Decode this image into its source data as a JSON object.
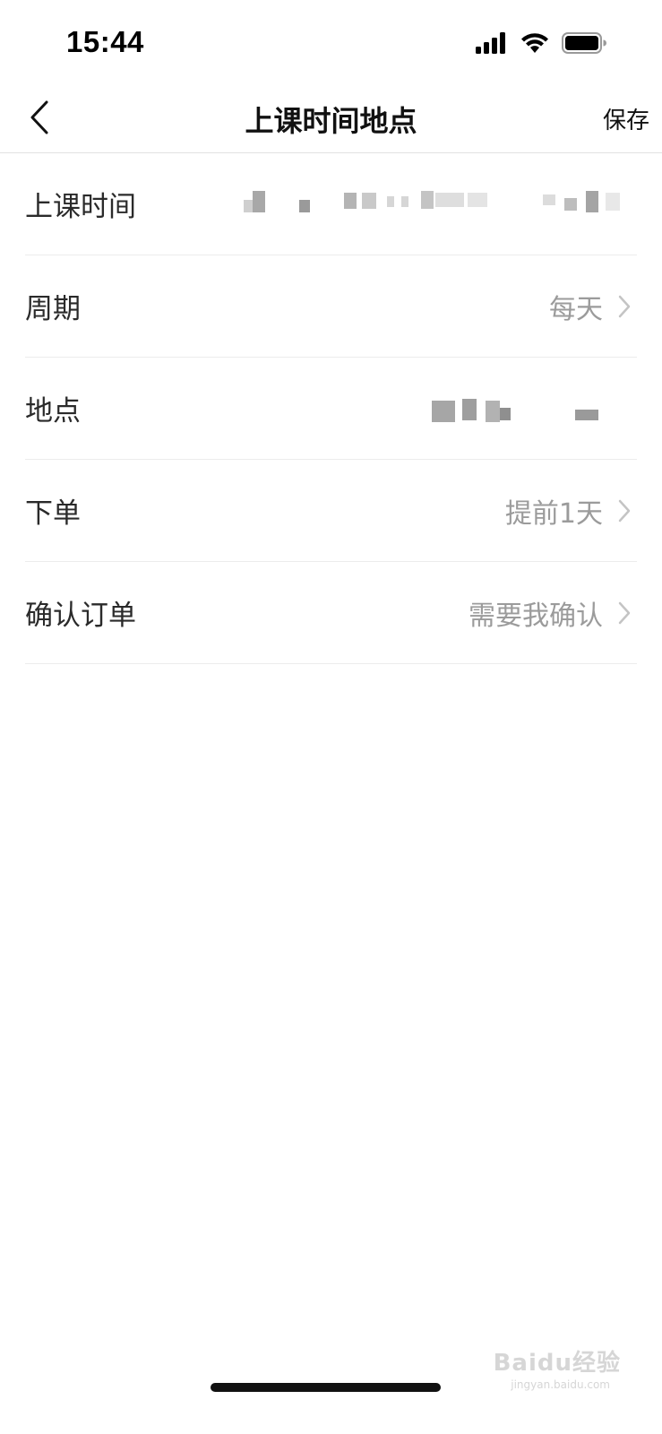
{
  "status_bar": {
    "time": "15:44",
    "icons": [
      "cellular-signal-icon",
      "wifi-icon",
      "battery-icon"
    ]
  },
  "nav": {
    "back_icon": "chevron-left-icon",
    "title": "上课时间地点",
    "save_label": "保存"
  },
  "rows": [
    {
      "label": "上课时间",
      "value": null,
      "value_obscured": true,
      "has_chevron": false
    },
    {
      "label": "周期",
      "value": "每天",
      "has_chevron": true
    },
    {
      "label": "地点",
      "value": null,
      "value_obscured": true,
      "has_chevron": false
    },
    {
      "label": "下单",
      "value": "提前1天",
      "has_chevron": true
    },
    {
      "label": "确认订单",
      "value": "需要我确认",
      "has_chevron": true
    }
  ],
  "watermark": {
    "text": "Baidu经验",
    "sub": "jingyan.baidu.com"
  },
  "colors": {
    "title": "#111111",
    "label": "#2a2a2a",
    "value": "#9b9b9b",
    "divider": "#ececec",
    "chevron": "#c4c4c4"
  }
}
